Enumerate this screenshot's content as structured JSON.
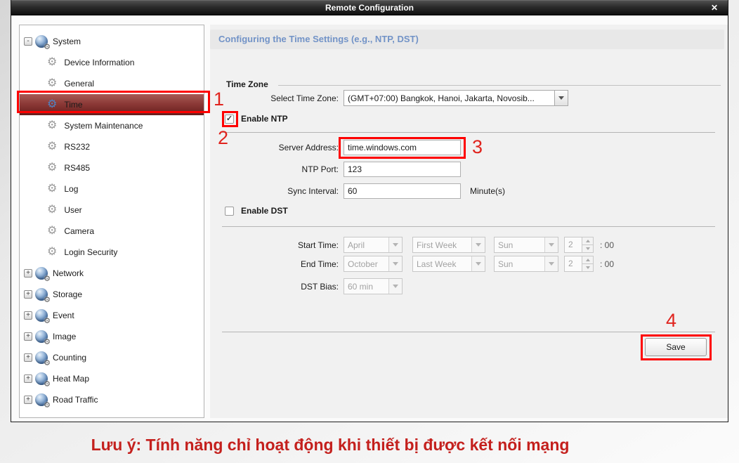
{
  "window": {
    "title": "Remote Configuration",
    "close_glyph": "✕"
  },
  "icons": {
    "gear": "⚙",
    "checkmark": "✓"
  },
  "sidebar": {
    "items": [
      {
        "label": "System",
        "expander": "-"
      },
      {
        "label": "Device Information"
      },
      {
        "label": "General"
      },
      {
        "label": "Time",
        "selected": true
      },
      {
        "label": "System Maintenance"
      },
      {
        "label": "RS232"
      },
      {
        "label": "RS485"
      },
      {
        "label": "Log"
      },
      {
        "label": "User"
      },
      {
        "label": "Camera"
      },
      {
        "label": "Login Security"
      },
      {
        "label": "Network",
        "expander": "+"
      },
      {
        "label": "Storage",
        "expander": "+"
      },
      {
        "label": "Event",
        "expander": "+"
      },
      {
        "label": "Image",
        "expander": "+"
      },
      {
        "label": "Counting",
        "expander": "+"
      },
      {
        "label": "Heat Map",
        "expander": "+"
      },
      {
        "label": "Road Traffic",
        "expander": "+"
      }
    ]
  },
  "main": {
    "header": "Configuring the Time Settings (e.g., NTP, DST)",
    "time_zone": {
      "section_title": "Time Zone",
      "select_label": "Select Time Zone:",
      "selected_value": "(GMT+07:00) Bangkok, Hanoi, Jakarta, Novosib..."
    },
    "ntp": {
      "enable_label": "Enable NTP",
      "checked": true,
      "server_label": "Server Address:",
      "server_value": "time.windows.com",
      "port_label": "NTP Port:",
      "port_value": "123",
      "interval_label": "Sync Interval:",
      "interval_value": "60",
      "interval_unit": "Minute(s)"
    },
    "dst": {
      "enable_label": "Enable DST",
      "checked": false,
      "start_label": "Start Time:",
      "start_month": "April",
      "start_week": "First Week",
      "start_day": "Sun",
      "start_hour": "2",
      "end_label": "End Time:",
      "end_month": "October",
      "end_week": "Last Week",
      "end_day": "Sun",
      "end_hour": "2",
      "minute_suffix": ": 00",
      "bias_label": "DST Bias:",
      "bias_value": "60 min"
    },
    "save_label": "Save"
  },
  "annotations": {
    "step1": "1",
    "step2": "2",
    "step3": "3",
    "step4": "4"
  },
  "footer": {
    "note": "Lưu ý: Tính năng chỉ hoạt động khi thiết bị được kết nối mạng"
  },
  "colors": {
    "annotation_red": "#fe0000",
    "number_red": "#e0241e",
    "header_blue": "#7293c7",
    "selected_row": "#8c3a37",
    "note_red": "#c4201d"
  }
}
